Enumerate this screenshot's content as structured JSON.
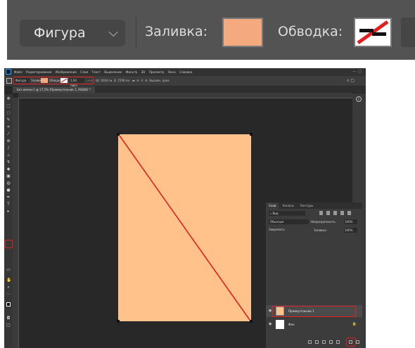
{
  "crop": {
    "shape_mode": "Фигура",
    "fill_label": "Заливка:",
    "stroke_label": "Обводка:",
    "fill_color": "#f5a97f",
    "stroke_preview": "white swatch with red diagonal (no stroke)"
  },
  "menubar": {
    "items": [
      "Файл",
      "Редактирование",
      "Изображение",
      "Слои",
      "Текст",
      "Выделение",
      "Фильтр",
      "3D",
      "Просмотр",
      "Окно",
      "Справка"
    ]
  },
  "options_bar": {
    "shape_mode": "Фигура",
    "fill_label": "Заливка:",
    "stroke_label": "Обводка:",
    "stroke_width": "1,00 пикс.",
    "w_label": "Ш:",
    "w_value": "1838 пи",
    "h_label": "В:",
    "h_value": "2598 пи",
    "align_edges": "Выровн. края"
  },
  "document": {
    "tab_title": "Без имени-1 @ 27,5% (Прямоугольник 1, RGB/8) *",
    "fill_color": "#ffc28a",
    "stroke_line_color": "#e02020"
  },
  "layers_panel": {
    "tabs": [
      "Слои",
      "Каналы",
      "Контуры"
    ],
    "kind_filter": "Вид",
    "blend_mode": "Обычные",
    "opacity_label": "Непрозрачность:",
    "opacity_value": "100%",
    "lock_label": "Закрепить:",
    "fill_label": "Заливка:",
    "fill_value": "100%",
    "layers": [
      {
        "name": "Прямоугольник 1",
        "selected": true
      },
      {
        "name": "Фон",
        "selected": false
      }
    ]
  },
  "icons": [
    "ps-logo",
    "search-icon",
    "info-icon",
    "eye-icon",
    "lock-icon",
    "new-layer-icon",
    "rectangle-tool-icon"
  ]
}
